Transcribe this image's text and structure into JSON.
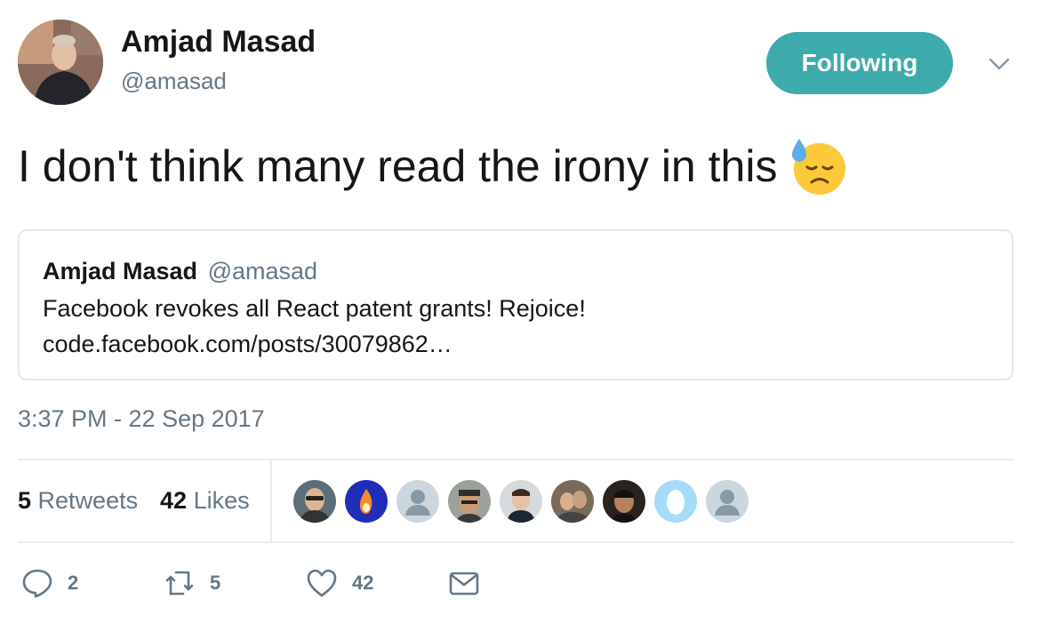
{
  "author": {
    "name": "Amjad Masad",
    "handle": "@amasad",
    "follow_label": "Following"
  },
  "tweet": {
    "text": "I don't think many read the irony in this",
    "emoji": "downcast-face-with-sweat-icon"
  },
  "quoted_tweet": {
    "name": "Amjad Masad",
    "handle": "@amasad",
    "text": "Facebook revokes all React patent grants! Rejoice!",
    "link": "code.facebook.com/posts/30079862…"
  },
  "timestamp": "3:37 PM - 22 Sep 2017",
  "stats": {
    "retweets_count": "5",
    "retweets_label": "Retweets",
    "likes_count": "42",
    "likes_label": "Likes"
  },
  "actions": {
    "reply_count": "2",
    "retweet_count": "5",
    "like_count": "42"
  },
  "colors": {
    "accent": "#3daaab",
    "text": "#14171a",
    "muted": "#657786",
    "border": "#e1e8ed"
  }
}
